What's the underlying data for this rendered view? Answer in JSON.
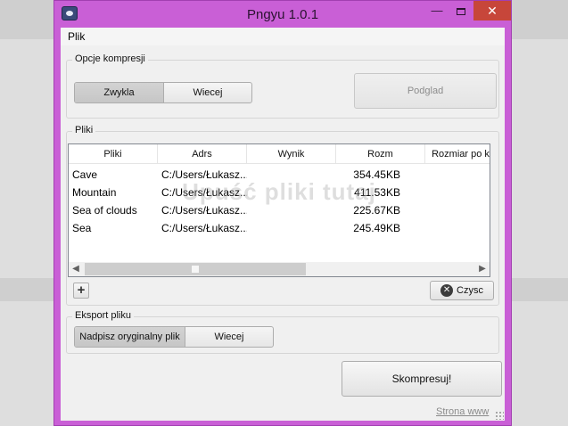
{
  "window": {
    "title": "Pngyu 1.0.1",
    "minimize_glyph": "—",
    "close_glyph": "✕"
  },
  "menu": {
    "items": [
      "Plik"
    ]
  },
  "compression": {
    "group_label": "Opcje kompresji",
    "mode_simple": "Zwykla",
    "mode_more": "Wiecej",
    "preview_button": "Podglad",
    "preview_enabled": false
  },
  "files": {
    "group_label": "Pliki",
    "columns": [
      "Pliki",
      "Adrs",
      "Wynik",
      "Rozm",
      "Rozmiar po k"
    ],
    "rows": [
      {
        "name": "Cave",
        "path": "C:/Users/Łukasz...",
        "result": "",
        "size": "354.45KB"
      },
      {
        "name": "Mountain",
        "path": "C:/Users/Łukasz...",
        "result": "",
        "size": "411.53KB"
      },
      {
        "name": "Sea of clouds",
        "path": "C:/Users/Łukasz...",
        "result": "",
        "size": "225.67KB"
      },
      {
        "name": "Sea",
        "path": "C:/Users/Łukasz...",
        "result": "",
        "size": "245.49KB"
      }
    ],
    "drop_hint": "Upuść pliki tutaj",
    "add_button": "+",
    "clear_button": "Czysc"
  },
  "export": {
    "group_label": "Eksport pliku",
    "overwrite_option": "Nadpisz oryginalny plik",
    "more_option": "Wiecej"
  },
  "actions": {
    "compress_button": "Skompresuj!",
    "website_link": "Strona www"
  },
  "colors": {
    "titlebar": "#c95fd6",
    "close_button": "#c7463a",
    "client_background": "#f0f0f0"
  }
}
